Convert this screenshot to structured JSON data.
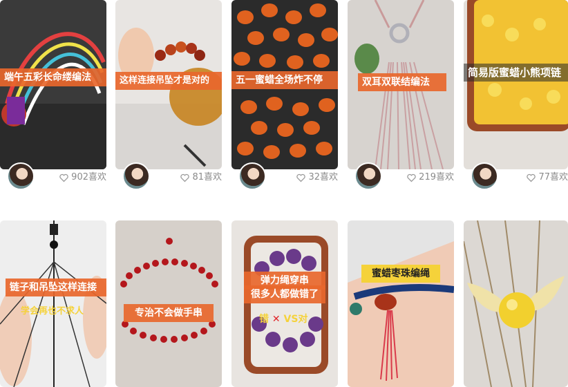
{
  "feed": {
    "row1": [
      {
        "title": "端午五彩长命缕编法",
        "likes": "902喜欢"
      },
      {
        "title": "这样连接吊坠才是对的",
        "likes": "81喜欢"
      },
      {
        "title": "五一蜜蜡全场炸不停",
        "likes": "32喜欢"
      },
      {
        "title": "双耳双联结编法",
        "likes": "219喜欢"
      },
      {
        "title": "简易版蜜蜡小熊项链",
        "likes": "77喜欢"
      }
    ],
    "row2": [
      {
        "title": "链子和吊坠这样连接",
        "subtitle": "学会再也不求人"
      },
      {
        "title": "专治不会做手串"
      },
      {
        "title": "弹力绳穿串",
        "subtitle": "很多人都做错了",
        "tag_wrong": "错",
        "tag_right": "VS对"
      },
      {
        "title": "蜜蜡枣珠编绳"
      },
      {
        "title": ""
      }
    ]
  },
  "icons": {
    "like": "heart-outline-icon"
  },
  "colors": {
    "banner": "#e8672d",
    "likes_text": "#8a8a8a"
  }
}
